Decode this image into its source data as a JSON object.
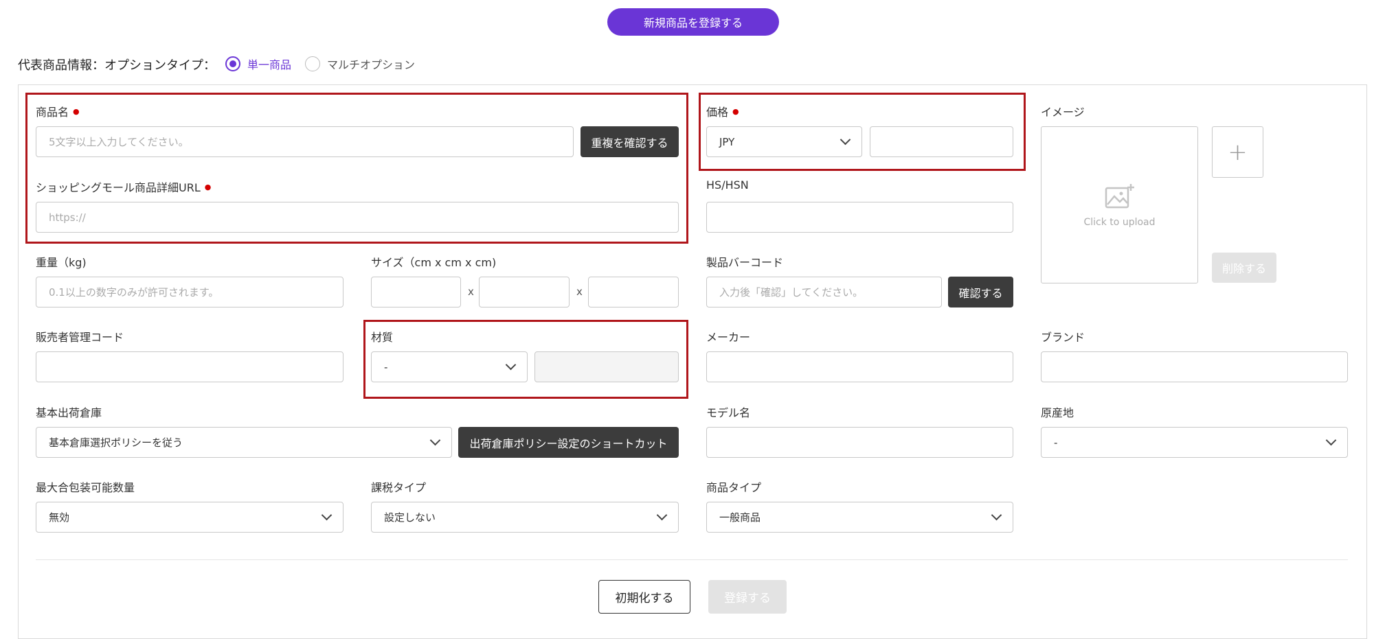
{
  "header": {
    "register_new_label": "新規商品を登録する"
  },
  "option_type": {
    "label": "代表商品情報：オプションタイプ：",
    "options": [
      {
        "label": "単一商品",
        "selected": true
      },
      {
        "label": "マルチオプション",
        "selected": false
      }
    ]
  },
  "form": {
    "product_name": {
      "label": "商品名",
      "placeholder": "5文字以上入力してください。",
      "check_button": "重複を確認する"
    },
    "mall_url": {
      "label": "ショッピングモール商品詳細URL",
      "placeholder": "https://"
    },
    "price": {
      "label": "価格",
      "currency": "JPY",
      "value": ""
    },
    "hs_hsn": {
      "label": "HS/HSN",
      "value": ""
    },
    "image": {
      "label": "イメージ",
      "upload_text": "Click to upload",
      "add_label": "+",
      "delete_label": "削除する"
    },
    "weight": {
      "label": "重量（kg)",
      "placeholder": "0.1以上の数字のみが許可されます。"
    },
    "size": {
      "label": "サイズ（cm x cm x cm)",
      "separator": "x"
    },
    "barcode": {
      "label": "製品バーコード",
      "placeholder": "入力後「確認」してください。",
      "confirm_button": "確認する"
    },
    "seller_code": {
      "label": "販売者管理コード",
      "value": ""
    },
    "material": {
      "label": "材質",
      "selected": "-"
    },
    "maker": {
      "label": "メーカー",
      "value": ""
    },
    "brand": {
      "label": "ブランド",
      "value": ""
    },
    "warehouse": {
      "label": "基本出荷倉庫",
      "selected": "基本倉庫選択ポリシーを従う",
      "shortcut_button": "出荷倉庫ポリシー設定のショートカット"
    },
    "model_name": {
      "label": "モデル名",
      "value": ""
    },
    "origin": {
      "label": "原産地",
      "selected": "-"
    },
    "max_package": {
      "label": "最大合包装可能数量",
      "selected": "無効"
    },
    "tax_type": {
      "label": "課税タイプ",
      "selected": "設定しない"
    },
    "product_type": {
      "label": "商品タイプ",
      "selected": "一般商品"
    }
  },
  "footer": {
    "reset_label": "初期化する",
    "submit_label": "登録する"
  },
  "colors": {
    "accent": "#6a35d6",
    "required": "#d40000",
    "highlight_border": "#b0161b",
    "dark_button": "#3c3c3c"
  }
}
